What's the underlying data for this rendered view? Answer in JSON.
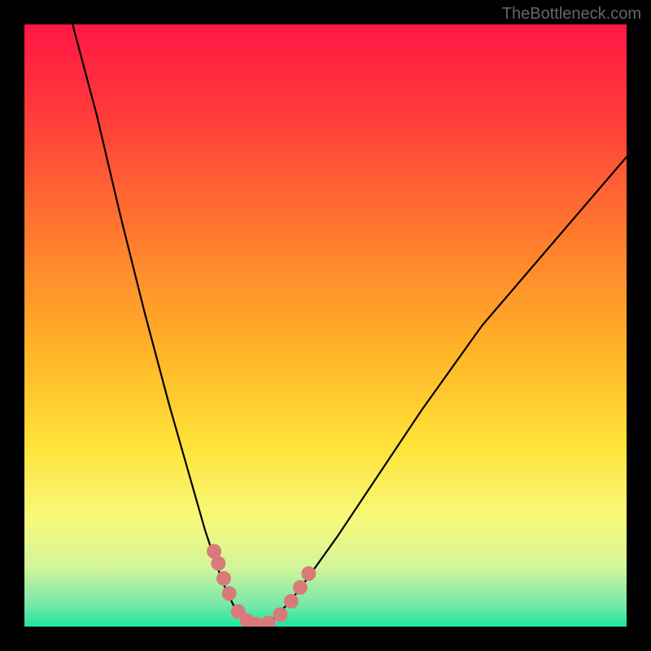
{
  "watermark": "TheBottleneck.com",
  "chart_data": {
    "type": "line",
    "title": "",
    "xlabel": "",
    "ylabel": "",
    "xlim": [
      0,
      100
    ],
    "ylim": [
      0,
      100
    ],
    "background_gradient": {
      "stops": [
        {
          "offset": 0.0,
          "color": "#ff1744"
        },
        {
          "offset": 0.15,
          "color": "#ff3b3b"
        },
        {
          "offset": 0.35,
          "color": "#ff7a2e"
        },
        {
          "offset": 0.55,
          "color": "#ffb627"
        },
        {
          "offset": 0.7,
          "color": "#ffe23a"
        },
        {
          "offset": 0.82,
          "color": "#f8f97a"
        },
        {
          "offset": 0.9,
          "color": "#d4f59a"
        },
        {
          "offset": 0.96,
          "color": "#7de8a8"
        },
        {
          "offset": 1.0,
          "color": "#1fe6a0"
        }
      ]
    },
    "series": [
      {
        "name": "bottleneck-curve-left",
        "x": [
          8,
          12,
          16,
          20,
          24,
          28,
          30,
          32,
          33.5,
          35,
          37,
          39
        ],
        "y": [
          100,
          85,
          68,
          52,
          37,
          23,
          16,
          10,
          6,
          3,
          1,
          0
        ]
      },
      {
        "name": "bottleneck-curve-right",
        "x": [
          39,
          41,
          44,
          47,
          52,
          58,
          66,
          76,
          88,
          100
        ],
        "y": [
          0,
          1,
          4,
          8,
          15,
          24,
          36,
          50,
          64,
          78
        ]
      },
      {
        "name": "marker-dots-left",
        "x": [
          31.5,
          32.2,
          33.1,
          34.0,
          35.5,
          37.0,
          38.5
        ],
        "y": [
          12.5,
          10.5,
          8.0,
          5.5,
          2.5,
          1.0,
          0.4
        ]
      },
      {
        "name": "marker-dots-right",
        "x": [
          40.5,
          42.5,
          44.3,
          45.8,
          47.2
        ],
        "y": [
          0.6,
          2.0,
          4.2,
          6.5,
          8.8
        ]
      }
    ],
    "colors": {
      "curve": "#000000",
      "marker": "#d97a7a"
    }
  }
}
